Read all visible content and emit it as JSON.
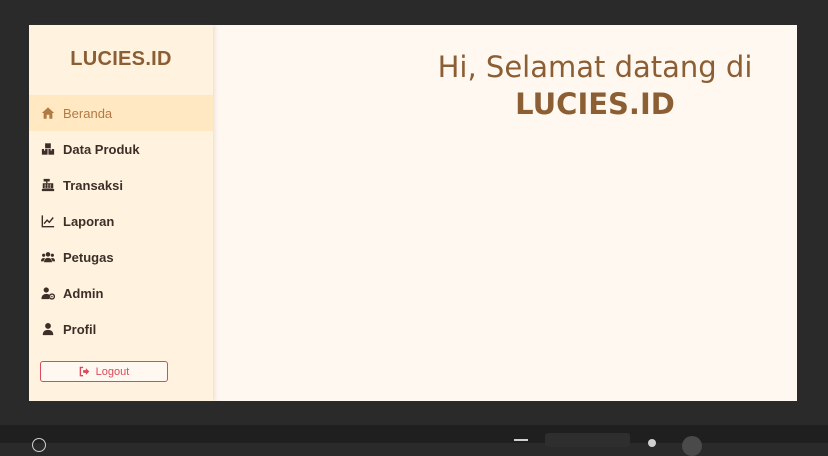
{
  "sidebar": {
    "brand": "LUCIES.ID",
    "items": [
      {
        "label": "Beranda",
        "icon": "home-icon",
        "active": true
      },
      {
        "label": "Data Produk",
        "icon": "boxes-icon",
        "active": false
      },
      {
        "label": "Transaksi",
        "icon": "cash-register-icon",
        "active": false
      },
      {
        "label": "Laporan",
        "icon": "line-chart-icon",
        "active": false
      },
      {
        "label": "Petugas",
        "icon": "users-icon",
        "active": false
      },
      {
        "label": "Admin",
        "icon": "user-cog-icon",
        "active": false
      },
      {
        "label": "Profil",
        "icon": "user-icon",
        "active": false
      }
    ],
    "logout_label": "Logout"
  },
  "main": {
    "welcome_line1": "Hi, Selamat datang di",
    "welcome_line2": "LUCIES.ID"
  },
  "colors": {
    "brand": "#8b5e34",
    "active_bg": "#ffe8c2",
    "active_text": "#b07a45",
    "logout": "#d94b5a",
    "content_bg": "#fff8f1",
    "sidebar_bg": "#fff3e0"
  }
}
